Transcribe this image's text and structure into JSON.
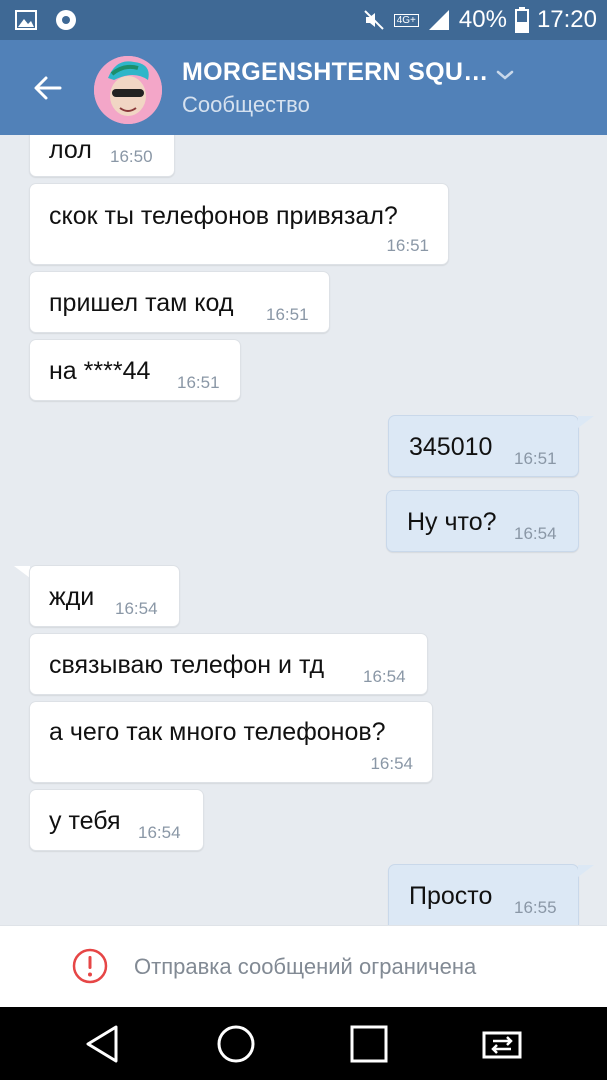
{
  "status_bar": {
    "battery": "40%",
    "time": "17:20",
    "network": "4G+",
    "icons": [
      "gallery-icon",
      "chrome-icon",
      "mute-icon",
      "signal-icon",
      "battery-icon"
    ]
  },
  "header": {
    "title": "MORGENSHTERN SQU…",
    "subtitle": "Сообщество",
    "icons": [
      "back-arrow-icon",
      "avatar",
      "chevron-down-icon"
    ]
  },
  "messages": [
    {
      "dir": "in",
      "text": "лол",
      "time": "16:50"
    },
    {
      "dir": "in",
      "text": "скок ты телефонов привязал?",
      "time": "16:51"
    },
    {
      "dir": "in",
      "text": "пришел там код",
      "time": "16:51"
    },
    {
      "dir": "in",
      "text": "на ****44",
      "time": "16:51"
    },
    {
      "dir": "out",
      "text": "345010",
      "time": "16:51"
    },
    {
      "dir": "out",
      "text": "Ну что?",
      "time": "16:54"
    },
    {
      "dir": "in",
      "text": "жди",
      "time": "16:54"
    },
    {
      "dir": "in",
      "text": "связываю телефон и тд",
      "time": "16:54"
    },
    {
      "dir": "in",
      "text": "а чего так много телефонов?",
      "time": "16:54"
    },
    {
      "dir": "in",
      "text": "у тебя",
      "time": "16:54"
    },
    {
      "dir": "out",
      "text": "Просто",
      "time": "16:55"
    }
  ],
  "restriction": {
    "text": "Отправка сообщений ограничена",
    "icon": "alert-circle-icon"
  },
  "nav": {
    "icons": [
      "back-triangle-icon",
      "home-circle-icon",
      "recents-square-icon",
      "switch-app-icon"
    ]
  },
  "colors": {
    "status_bar": "#3f6995",
    "header": "#5181b8",
    "chat_bg": "#e7ebf0",
    "incoming_bubble": "#ffffff",
    "outgoing_bubble": "#dce8f5",
    "alert": "#e64646"
  }
}
